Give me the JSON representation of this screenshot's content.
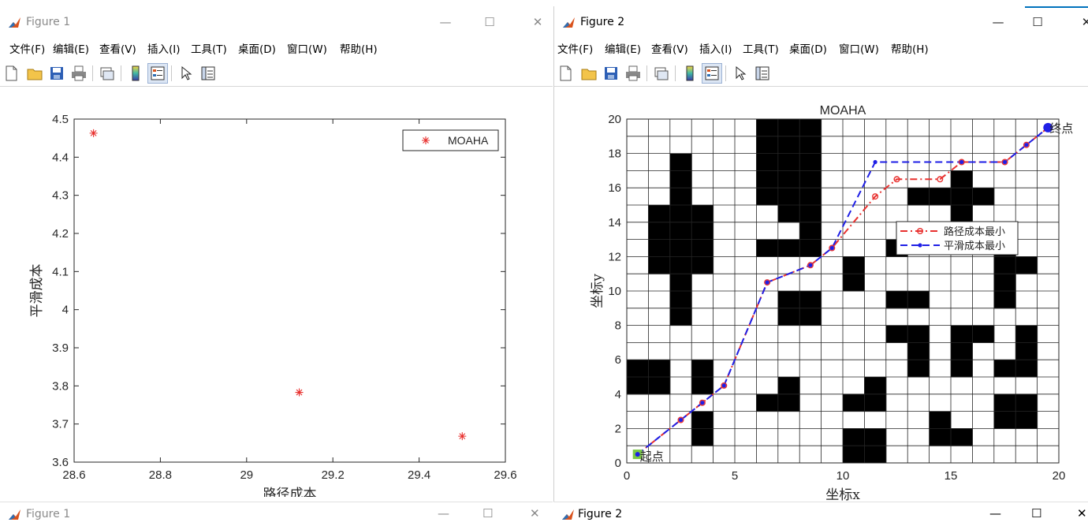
{
  "window1": {
    "title": "Figure 1",
    "bottom_title": "Figure 1",
    "menu": [
      "文件(F)",
      "编辑(E)",
      "查看(V)",
      "插入(I)",
      "工具(T)",
      "桌面(D)",
      "窗口(W)",
      "帮助(H)"
    ],
    "controls": {
      "minimize": "—",
      "maximize": "☐",
      "close": "✕"
    }
  },
  "window2": {
    "title": "Figure 2",
    "bottom_title": "Figure 2",
    "menu": [
      "文件(F)",
      "编辑(E)",
      "查看(V)",
      "插入(I)",
      "工具(T)",
      "桌面(D)",
      "窗口(W)",
      "帮助(H)"
    ],
    "controls": {
      "minimize": "—",
      "maximize": "☐",
      "close": "✕"
    }
  },
  "toolbar_icons": [
    "new-figure-icon",
    "open-file-icon",
    "save-icon",
    "print-icon",
    "link-plot-icon",
    "insert-colorbar-icon",
    "insert-legend-icon",
    "edit-plot-icon",
    "property-inspector-icon"
  ],
  "colors": {
    "accent": "#0072bd",
    "pareto_marker": "#e8302e",
    "path_red": "#e8302e",
    "path_blue": "#1f1fe6",
    "obstacle": "#000000",
    "start_marker": "#7ac943"
  },
  "chart_data": [
    {
      "type": "scatter",
      "title": "",
      "xlabel": "路径成本",
      "ylabel": "平滑成本",
      "xlim": [
        28.6,
        29.6
      ],
      "ylim": [
        3.6,
        4.5
      ],
      "xticks": [
        28.6,
        28.8,
        29,
        29.2,
        29.4,
        29.6
      ],
      "xtick_labels": [
        "28.6",
        "28.8",
        "29",
        "29.2",
        "29.4",
        "29.6"
      ],
      "yticks": [
        3.6,
        3.7,
        3.8,
        3.9,
        4,
        4.1,
        4.2,
        4.3,
        4.4,
        4.5
      ],
      "ytick_labels": [
        "3.6",
        "3.7",
        "3.8",
        "3.9",
        "4",
        "4.1",
        "4.2",
        "4.3",
        "4.4",
        "4.5"
      ],
      "grid": false,
      "legend_position": "top-right",
      "series": [
        {
          "name": "MOAHA",
          "marker": "*",
          "color": "#e8302e",
          "points": [
            [
              28.645,
              4.463
            ],
            [
              29.122,
              3.783
            ],
            [
              29.5,
              3.668
            ]
          ]
        }
      ]
    },
    {
      "type": "line",
      "title": "MOAHA",
      "xlabel": "坐标x",
      "ylabel": "坐标y",
      "xlim": [
        0,
        20
      ],
      "ylim": [
        0,
        20
      ],
      "xticks": [
        0,
        5,
        10,
        15,
        20
      ],
      "xtick_labels": [
        "0",
        "5",
        "10",
        "15",
        "20"
      ],
      "yticks": [
        0,
        2,
        4,
        6,
        8,
        10,
        12,
        14,
        16,
        18,
        20
      ],
      "ytick_labels": [
        "0",
        "2",
        "4",
        "6",
        "8",
        "10",
        "12",
        "14",
        "16",
        "18",
        "20"
      ],
      "grid": true,
      "legend_position": "right",
      "start_label": "起点",
      "end_label": "终点",
      "start_point": [
        0.5,
        0.5
      ],
      "end_point": [
        19.5,
        19.5
      ],
      "obstacle_cells": [
        [
          0,
          4
        ],
        [
          0,
          5
        ],
        [
          1,
          4
        ],
        [
          1,
          5
        ],
        [
          2,
          8
        ],
        [
          2,
          9
        ],
        [
          2,
          10
        ],
        [
          2,
          11
        ],
        [
          2,
          12
        ],
        [
          2,
          13
        ],
        [
          2,
          14
        ],
        [
          2,
          15
        ],
        [
          2,
          16
        ],
        [
          2,
          17
        ],
        [
          1,
          11
        ],
        [
          1,
          12
        ],
        [
          1,
          13
        ],
        [
          1,
          14
        ],
        [
          3,
          11
        ],
        [
          3,
          12
        ],
        [
          3,
          13
        ],
        [
          3,
          14
        ],
        [
          3,
          1
        ],
        [
          3,
          2
        ],
        [
          3,
          4
        ],
        [
          3,
          5
        ],
        [
          6,
          15
        ],
        [
          6,
          16
        ],
        [
          6,
          17
        ],
        [
          6,
          18
        ],
        [
          6,
          19
        ],
        [
          7,
          14
        ],
        [
          7,
          15
        ],
        [
          7,
          16
        ],
        [
          7,
          17
        ],
        [
          7,
          18
        ],
        [
          7,
          19
        ],
        [
          8,
          14
        ],
        [
          8,
          15
        ],
        [
          8,
          16
        ],
        [
          8,
          17
        ],
        [
          8,
          18
        ],
        [
          8,
          19
        ],
        [
          6,
          12
        ],
        [
          7,
          12
        ],
        [
          8,
          12
        ],
        [
          8,
          13
        ],
        [
          7,
          8
        ],
        [
          8,
          8
        ],
        [
          7,
          9
        ],
        [
          8,
          9
        ],
        [
          6,
          3
        ],
        [
          7,
          3
        ],
        [
          7,
          4
        ],
        [
          10,
          10
        ],
        [
          10,
          11
        ],
        [
          10,
          0
        ],
        [
          11,
          0
        ],
        [
          10,
          1
        ],
        [
          11,
          1
        ],
        [
          10,
          3
        ],
        [
          11,
          3
        ],
        [
          11,
          4
        ],
        [
          12,
          12
        ],
        [
          12,
          9
        ],
        [
          13,
          9
        ],
        [
          12,
          7
        ],
        [
          13,
          7
        ],
        [
          13,
          6
        ],
        [
          13,
          5
        ],
        [
          13,
          15
        ],
        [
          14,
          15
        ],
        [
          15,
          15
        ],
        [
          16,
          15
        ],
        [
          15,
          14
        ],
        [
          15,
          16
        ],
        [
          14,
          1
        ],
        [
          14,
          2
        ],
        [
          15,
          1
        ],
        [
          15,
          5
        ],
        [
          15,
          6
        ],
        [
          15,
          7
        ],
        [
          16,
          7
        ],
        [
          17,
          9
        ],
        [
          17,
          10
        ],
        [
          17,
          11
        ],
        [
          17,
          12
        ],
        [
          18,
          11
        ],
        [
          17,
          5
        ],
        [
          18,
          5
        ],
        [
          18,
          6
        ],
        [
          18,
          7
        ],
        [
          17,
          2
        ],
        [
          18,
          2
        ],
        [
          17,
          3
        ],
        [
          18,
          3
        ]
      ],
      "series": [
        {
          "name": "路径成本最小",
          "style": "dash-dot",
          "marker": "o",
          "color": "#e8302e",
          "points": [
            [
              0.5,
              0.5
            ],
            [
              2.5,
              2.5
            ],
            [
              3.5,
              3.5
            ],
            [
              4.5,
              4.5
            ],
            [
              6.5,
              10.5
            ],
            [
              8.5,
              11.5
            ],
            [
              9.5,
              12.5
            ],
            [
              11.5,
              15.5
            ],
            [
              12.5,
              16.5
            ],
            [
              14.5,
              16.5
            ],
            [
              15.5,
              17.5
            ],
            [
              17.5,
              17.5
            ],
            [
              18.5,
              18.5
            ],
            [
              19.5,
              19.5
            ]
          ]
        },
        {
          "name": "平滑成本最小",
          "style": "dashed",
          "marker": ".",
          "color": "#1f1fe6",
          "points": [
            [
              0.5,
              0.5
            ],
            [
              2.5,
              2.5
            ],
            [
              3.5,
              3.5
            ],
            [
              4.5,
              4.5
            ],
            [
              6.5,
              10.5
            ],
            [
              8.5,
              11.5
            ],
            [
              9.5,
              12.5
            ],
            [
              11.5,
              17.5
            ],
            [
              15.5,
              17.5
            ],
            [
              17.5,
              17.5
            ],
            [
              18.5,
              18.5
            ],
            [
              19.5,
              19.5
            ]
          ]
        }
      ]
    }
  ]
}
